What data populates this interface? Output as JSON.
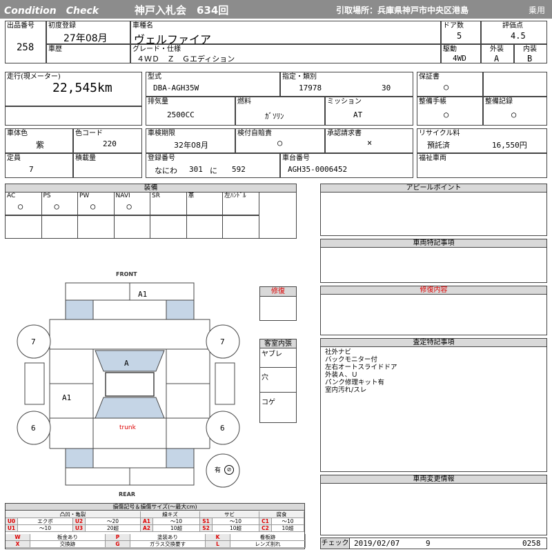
{
  "header": {
    "title": "Condition　Check",
    "auction": "神戸入札会　634回",
    "pickup": "引取場所：兵庫県神戸市中央区港島",
    "category": "乗用"
  },
  "basic": {
    "lot_label": "出品番号",
    "lot": "258",
    "first_reg_label": "初度登録",
    "first_reg": "27年08月",
    "name_label": "車種名",
    "name": "ヴェルファイア",
    "doors_label": "ドア数",
    "doors": "5",
    "score_label": "評価点",
    "score": "4.5",
    "history_label": "車歴",
    "grade_label": "グレード・仕様",
    "grade": "４ＷＤ　Ｚ　Ｇエディション",
    "drive_label": "駆動",
    "drive": "4WD",
    "exterior_label": "外装",
    "exterior": "A",
    "interior_label": "内装",
    "interior": "B"
  },
  "spec": {
    "mileage_label": "走行(現メーター)",
    "mileage": "22,545km",
    "model_label": "型式",
    "model": "DBA-AGH35W",
    "designation_label": "指定・類別",
    "designation": "17978",
    "classification": "30",
    "warranty_label": "保証書",
    "warranty": "○",
    "displacement_label": "排気量",
    "displacement": "2500CC",
    "fuel_label": "燃料",
    "fuel": "ｶﾞｿﾘﾝ",
    "mission_label": "ミッション",
    "mission": "AT",
    "manual_label": "整備手帳",
    "manual": "○",
    "record_label": "整備記録",
    "record": "○",
    "color_label": "車体色",
    "color": "紫",
    "color_code_label": "色コード",
    "color_code": "220",
    "inspection_label": "車検期限",
    "inspection": "32年08月",
    "insurance_label": "検付自賠責",
    "insurance": "○",
    "approval_label": "承認請求書",
    "approval": "×",
    "recycle_label": "リサイクル料",
    "recycle_status": "預託済",
    "recycle_fee": "16,550円",
    "capacity_label": "定員",
    "capacity": "7",
    "load_label": "積載量",
    "plate_label": "登録番号",
    "plate_area": "なにわ",
    "plate_class": "301",
    "plate_kana": "に",
    "plate_num": "592",
    "chassis_label": "車台番号",
    "chassis": "AGH35-0006452",
    "welfare_label": "福祉車両"
  },
  "equipment": {
    "title": "装備",
    "items": [
      {
        "label": "AC",
        "value": "○"
      },
      {
        "label": "PS",
        "value": "○"
      },
      {
        "label": "PW",
        "value": "○"
      },
      {
        "label": "NAVI",
        "value": "○"
      },
      {
        "label": "SR",
        "value": ""
      },
      {
        "label": "革",
        "value": ""
      },
      {
        "label": "左ﾊﾝﾄﾞﾙ",
        "value": ""
      }
    ]
  },
  "diagram": {
    "front": "FRONT",
    "rear": "REAR",
    "trunk": "trunk",
    "marks": {
      "top": "A1",
      "side": "A1",
      "roof": "A",
      "fl": "7",
      "fr": "7",
      "rl": "6",
      "rr": "6"
    },
    "smoke_label": "有",
    "repair_title": "修復",
    "interior_title": "客室内張",
    "interior_items": [
      "ヤブレ",
      "穴",
      "コゲ"
    ]
  },
  "panels": {
    "appeal": "アピールポイント",
    "special": "車両特記事項",
    "repair_detail": "修復内容",
    "assessment": "査定特記事項",
    "assessment_lines": [
      "社外ナビ",
      "バックモニター付",
      "左右オートスライドドア",
      "外装Ａ、Ｕ",
      "パンク修理キット有",
      "室内汚れ/スレ"
    ],
    "change": "車両変更情報"
  },
  "footer": {
    "check_label": "チェック",
    "date": "2019/02/07",
    "num": "9",
    "code": "0258"
  },
  "legend": {
    "title": "損傷記号＆損傷サイズ(〜最大cm)",
    "cols": [
      "凸凹・亀裂",
      "線キズ",
      "サビ",
      "腐食"
    ],
    "row1": [
      [
        "U0",
        "エクボ"
      ],
      [
        "U2",
        "〜20"
      ],
      [
        "A1",
        "〜10"
      ],
      [
        "S1",
        "〜10"
      ],
      [
        "C1",
        "〜10"
      ]
    ],
    "row2": [
      [
        "U1",
        "〜10"
      ],
      [
        "U3",
        "20超"
      ],
      [
        "A2",
        "10超"
      ],
      [
        "S2",
        "10超"
      ],
      [
        "C2",
        "10超"
      ]
    ],
    "row3": [
      [
        "W",
        "板金あり"
      ],
      [
        "P",
        "塗装あり"
      ],
      [
        "K",
        "看板跡"
      ]
    ],
    "row4": [
      [
        "X",
        "交換跡"
      ],
      [
        "G",
        "ガラス交換要す"
      ],
      [
        "L",
        "レンズ割れ"
      ]
    ]
  }
}
